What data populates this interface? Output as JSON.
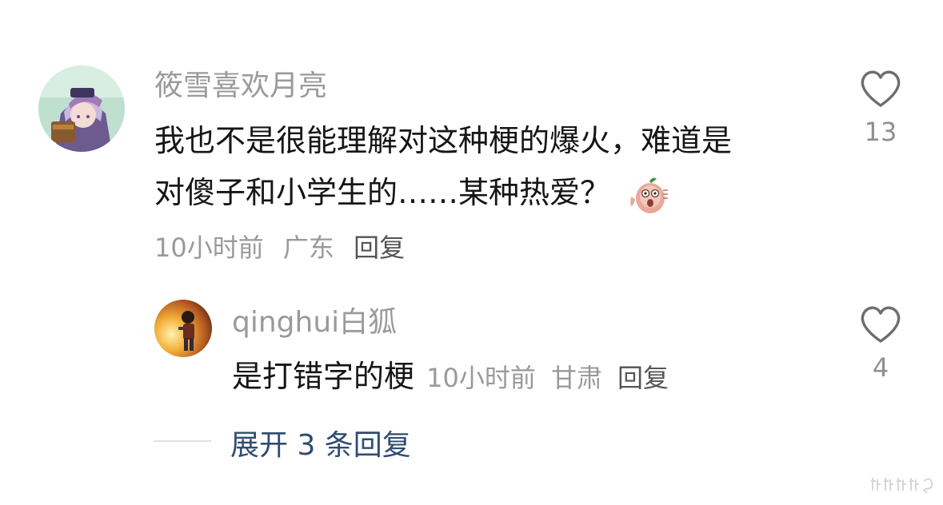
{
  "main_comment": {
    "username": "筱雪喜欢月亮",
    "text_line1": "我也不是很能理解对这种梗的爆火，难道是",
    "text_line2": "对傻子和小学生的……某种热爱？",
    "emoji": "shocked-sweet-potato-emoji",
    "time": "10小时前",
    "location": "广东",
    "reply_label": "回复",
    "like_count": "13"
  },
  "reply_comment": {
    "username": "qinghui白狐",
    "text": "是打错字的梗",
    "time": "10小时前",
    "location": "甘肃",
    "reply_label": "回复",
    "like_count": "4"
  },
  "expand": {
    "label": "展开 3 条回复"
  },
  "icons": {
    "like": "heart-outline-icon"
  },
  "colors": {
    "username": "#9a9a9a",
    "text": "#161616",
    "meta": "#9a9a9a",
    "expand_link": "#2f4c73"
  }
}
